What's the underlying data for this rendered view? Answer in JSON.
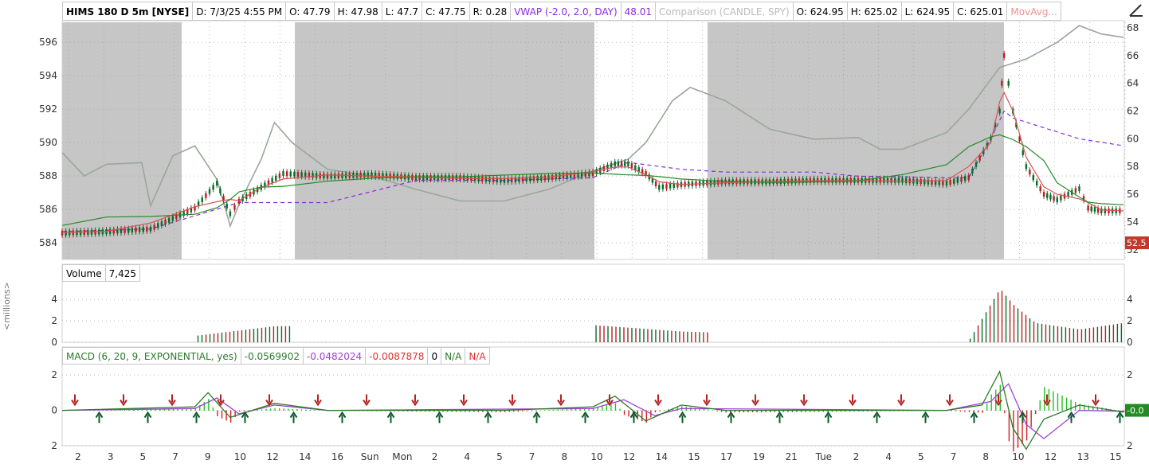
{
  "header": {
    "symbol": "HIMS 180 D 5m [NYSE]",
    "date": "D: 7/3/25 4:55 PM",
    "open": "O: 47.79",
    "high": "H: 47.98",
    "low": "L: 47.7",
    "close": "C: 47.75",
    "range": "R: 0.28",
    "vwap_label": "VWAP (-2.0, 2.0, DAY)",
    "vwap_value": "48.01",
    "comparison": "Comparison (CANDLE, SPY)",
    "cmp_open": "O: 624.95",
    "cmp_high": "H: 625.02",
    "cmp_low": "L: 624.95",
    "cmp_close": "C: 625.01",
    "movavg": "MovAvg..."
  },
  "volume_panel": {
    "label": "Volume",
    "value": "7,425",
    "axis_title": "<millions>"
  },
  "macd_panel": {
    "label": "MACD (6, 20, 9, EXPONENTIAL, yes)",
    "value": "-0.0569902",
    "avg": "-0.0482024",
    "diff": "-0.0087878",
    "zero": "0",
    "na1": "N/A",
    "na2": "N/A"
  },
  "colors": {
    "vwap": "#8a2be2",
    "diff": "#e03030",
    "macd": "#2b7a2b",
    "candle_up": "#0a6b2a",
    "candle_down": "#b22222",
    "comparison": "#9aa79a",
    "session_shade": "#c6c6c6"
  },
  "chart_data": [
    {
      "type": "line",
      "title": "HIMS 180 D 5m [NYSE]",
      "left_axis_ticks": [
        584,
        586,
        588,
        590,
        592,
        594,
        596
      ],
      "left_axis_range": [
        583,
        597.2
      ],
      "right_axis_ticks": [
        52,
        54,
        56,
        58,
        60,
        62,
        64,
        66,
        68
      ],
      "right_axis_range": [
        51.3,
        68.4
      ],
      "price_marker": "52.5",
      "x_tick_labels": [
        "2",
        "3",
        "5",
        "7",
        "9",
        "10",
        "12",
        "14",
        "16",
        "Sun",
        "Mon",
        "2",
        "4",
        "5",
        "7",
        "8",
        "10",
        "12",
        "14",
        "15",
        "17",
        "19",
        "21",
        "Tue",
        "2",
        "4",
        "5",
        "7",
        "8",
        "10",
        "12",
        "13",
        "15"
      ],
      "series": [
        {
          "name": "HIMS",
          "points": [
            [
              0,
              53.2
            ],
            [
              10,
              53.3
            ],
            [
              20,
              53.5
            ],
            [
              30,
              55.0
            ],
            [
              35,
              56.8
            ],
            [
              38,
              54.6
            ],
            [
              40,
              55.5
            ],
            [
              45,
              56.5
            ],
            [
              50,
              57.5
            ],
            [
              60,
              57.3
            ],
            [
              70,
              57.4
            ],
            [
              80,
              57.2
            ],
            [
              90,
              57.2
            ],
            [
              100,
              57.0
            ],
            [
              110,
              57.2
            ],
            [
              120,
              57.5
            ],
            [
              125,
              58.2
            ],
            [
              128,
              58.2
            ],
            [
              132,
              57.5
            ],
            [
              135,
              56.5
            ],
            [
              140,
              56.7
            ],
            [
              150,
              56.9
            ],
            [
              160,
              56.9
            ],
            [
              170,
              57.0
            ],
            [
              180,
              57.0
            ],
            [
              190,
              57.0
            ],
            [
              200,
              56.8
            ],
            [
              205,
              57.2
            ],
            [
              210,
              60.0
            ],
            [
              212,
              62.0
            ],
            [
              213,
              66.0
            ],
            [
              215,
              62.0
            ],
            [
              218,
              58.0
            ],
            [
              222,
              56.0
            ],
            [
              225,
              55.6
            ],
            [
              230,
              56.4
            ],
            [
              232,
              55.0
            ],
            [
              235,
              54.8
            ],
            [
              240,
              54.8
            ]
          ]
        },
        {
          "name": "SPY",
          "points": [
            [
              0,
              589.4
            ],
            [
              5,
              588.0
            ],
            [
              10,
              588.7
            ],
            [
              18,
              588.8
            ],
            [
              20,
              586.2
            ],
            [
              25,
              589.2
            ],
            [
              30,
              589.8
            ],
            [
              35,
              587.8
            ],
            [
              38,
              585.0
            ],
            [
              40,
              586.3
            ],
            [
              45,
              589.0
            ],
            [
              48,
              591.2
            ],
            [
              52,
              590.0
            ],
            [
              60,
              588.4
            ],
            [
              70,
              588.0
            ],
            [
              80,
              587.2
            ],
            [
              90,
              586.5
            ],
            [
              100,
              586.5
            ],
            [
              110,
              587.2
            ],
            [
              120,
              588.3
            ],
            [
              128,
              589.0
            ],
            [
              132,
              590.0
            ],
            [
              138,
              592.5
            ],
            [
              142,
              593.3
            ],
            [
              150,
              592.5
            ],
            [
              160,
              590.8
            ],
            [
              170,
              590.2
            ],
            [
              180,
              590.3
            ],
            [
              185,
              589.6
            ],
            [
              190,
              589.6
            ],
            [
              200,
              590.6
            ],
            [
              205,
              592.0
            ],
            [
              212,
              594.5
            ],
            [
              218,
              595.0
            ],
            [
              225,
              596.0
            ],
            [
              230,
              597.0
            ],
            [
              235,
              596.5
            ],
            [
              240,
              596.3
            ]
          ]
        },
        {
          "name": "VWAP",
          "points": [
            [
              0,
              53.3
            ],
            [
              20,
              53.5
            ],
            [
              40,
              55.4
            ],
            [
              60,
              55.4
            ],
            [
              80,
              57.0
            ],
            [
              100,
              57.0
            ],
            [
              120,
              57.2
            ],
            [
              128,
              58.3
            ],
            [
              140,
              57.8
            ],
            [
              150,
              57.6
            ],
            [
              160,
              57.6
            ],
            [
              170,
              57.6
            ],
            [
              180,
              57.3
            ],
            [
              200,
              57.2
            ],
            [
              205,
              57.2
            ],
            [
              210,
              60.0
            ],
            [
              213,
              62.0
            ],
            [
              215,
              61.5
            ],
            [
              220,
              61.0
            ],
            [
              230,
              60.0
            ],
            [
              240,
              59.5
            ]
          ]
        }
      ]
    },
    {
      "type": "bar",
      "title": "Volume",
      "ylabel": "<millions>",
      "y_ticks": [
        0,
        2,
        4
      ],
      "ylim": [
        0,
        5.5
      ],
      "series": [
        {
          "name": "Volume",
          "points": [
            [
              30,
              0.6
            ],
            [
              48,
              1.5
            ],
            [
              120,
              1.6
            ],
            [
              140,
              1.0
            ],
            [
              205,
              0.2
            ],
            [
              212,
              5.0
            ],
            [
              215,
              3.5
            ],
            [
              220,
              1.8
            ],
            [
              230,
              1.2
            ],
            [
              240,
              1.8
            ]
          ]
        }
      ]
    },
    {
      "type": "line",
      "title": "MACD (6, 20, 9, EXPONENTIAL, yes)",
      "y_ticks": [
        2,
        0,
        2
      ],
      "ylim": [
        -2,
        2.5
      ],
      "series": [
        {
          "name": "MACD",
          "points": [
            [
              0,
              0
            ],
            [
              30,
              0.2
            ],
            [
              33,
              1.0
            ],
            [
              38,
              -0.4
            ],
            [
              48,
              0.4
            ],
            [
              60,
              0
            ],
            [
              100,
              0
            ],
            [
              120,
              0.2
            ],
            [
              125,
              0.8
            ],
            [
              132,
              -0.6
            ],
            [
              140,
              0.3
            ],
            [
              150,
              0
            ],
            [
              200,
              0
            ],
            [
              208,
              0.3
            ],
            [
              212,
              2.2
            ],
            [
              215,
              -1.0
            ],
            [
              218,
              -2.2
            ],
            [
              222,
              -0.5
            ],
            [
              230,
              0.3
            ],
            [
              240,
              -0.1
            ]
          ]
        },
        {
          "name": "MACD Avg",
          "points": [
            [
              0,
              0
            ],
            [
              30,
              0.1
            ],
            [
              35,
              0.7
            ],
            [
              40,
              -0.2
            ],
            [
              48,
              0.3
            ],
            [
              60,
              0
            ],
            [
              120,
              0.1
            ],
            [
              127,
              0.6
            ],
            [
              134,
              -0.3
            ],
            [
              140,
              0.1
            ],
            [
              200,
              0
            ],
            [
              210,
              0.5
            ],
            [
              214,
              1.5
            ],
            [
              218,
              -0.8
            ],
            [
              222,
              -1.6
            ],
            [
              230,
              0
            ],
            [
              240,
              -0.05
            ]
          ]
        }
      ],
      "value_marker": "-0.0"
    }
  ]
}
